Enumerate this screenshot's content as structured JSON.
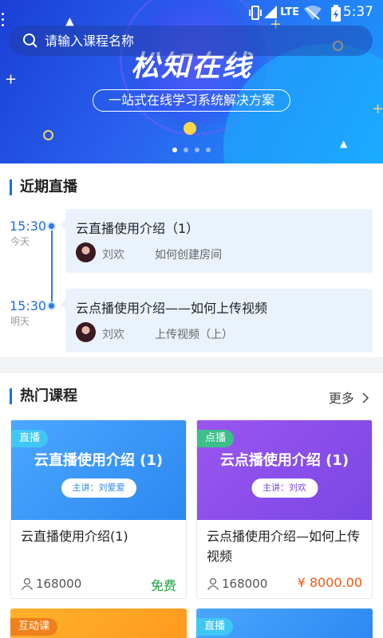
{
  "status_bar": {
    "time": "5:37",
    "network": "LTE"
  },
  "banner": {
    "brand": "松知在线",
    "slogan": "一站式在线学习系统解决方案",
    "slides": 4,
    "active_slide": 1
  },
  "search": {
    "placeholder": "请输入课程名称"
  },
  "live_section": {
    "title": "近期直播",
    "items": [
      {
        "time": "15:30",
        "day": "今天",
        "title": "云直播使用介绍（1）",
        "teacher": "刘欢",
        "topic": "如何创建房间"
      },
      {
        "time": "15:30",
        "day": "明天",
        "title": "云点播使用介绍——如何上传视频",
        "teacher": "刘欢",
        "topic": "上传视频（上）"
      }
    ]
  },
  "hot_section": {
    "title": "热门课程",
    "more": "更多",
    "courses": [
      {
        "tag": "直播",
        "banner_title": "云直播使用介绍 (1)",
        "speaker": "主讲：刘爱爱",
        "title": "云直播使用介绍(1)",
        "students": "168000",
        "price": "免费",
        "price_color": "#1aa33a"
      },
      {
        "tag": "点播",
        "banner_title": "云点播使用介绍 (1)",
        "speaker": "主讲：刘欢",
        "title": "云点播使用介绍—如何上传视频",
        "students": "168000",
        "price": "¥ 8000.00",
        "price_color": "#f05a14"
      }
    ],
    "more_courses": [
      {
        "tag": "互动课"
      },
      {
        "tag": "直播"
      }
    ]
  },
  "colors": {
    "accent": "#1f6fe0",
    "live_card_bg": "#eaf2fd"
  }
}
